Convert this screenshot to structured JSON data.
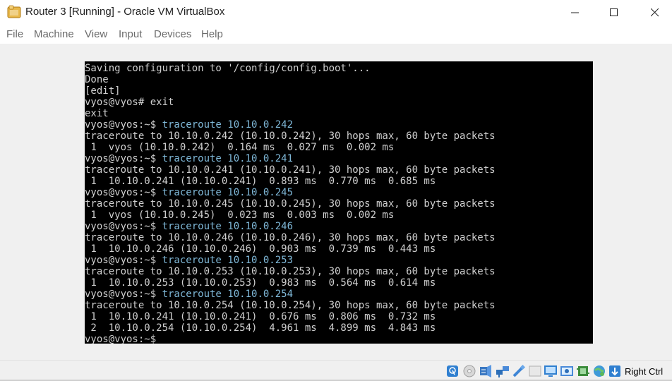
{
  "window": {
    "title": "Router 3 [Running] - Oracle VM VirtualBox",
    "controls": [
      "minimize",
      "maximize",
      "close"
    ]
  },
  "menu": {
    "items": [
      {
        "label": "File"
      },
      {
        "label": "Machine"
      },
      {
        "label": "View"
      },
      {
        "label": "Input"
      },
      {
        "label": "Devices"
      },
      {
        "label": "Help"
      }
    ]
  },
  "terminal": {
    "colors": {
      "background": "#000000",
      "text": "#cfcfcf",
      "command": "#7fb8d8"
    },
    "lines": [
      {
        "text": "Saving configuration to '/config/config.boot'...",
        "cmd": ""
      },
      {
        "text": "Done",
        "cmd": ""
      },
      {
        "text": "[edit]",
        "cmd": ""
      },
      {
        "text": "vyos@vyos# exit",
        "cmd": ""
      },
      {
        "text": "exit",
        "cmd": ""
      },
      {
        "text": "vyos@vyos:~$ ",
        "cmd": "traceroute 10.10.0.242"
      },
      {
        "text": "traceroute to 10.10.0.242 (10.10.0.242), 30 hops max, 60 byte packets",
        "cmd": ""
      },
      {
        "text": " 1  vyos (10.10.0.242)  0.164 ms  0.027 ms  0.002 ms",
        "cmd": ""
      },
      {
        "text": "vyos@vyos:~$ ",
        "cmd": "traceroute 10.10.0.241"
      },
      {
        "text": "traceroute to 10.10.0.241 (10.10.0.241), 30 hops max, 60 byte packets",
        "cmd": ""
      },
      {
        "text": " 1  10.10.0.241 (10.10.0.241)  0.893 ms  0.770 ms  0.685 ms",
        "cmd": ""
      },
      {
        "text": "vyos@vyos:~$ ",
        "cmd": "traceroute 10.10.0.245"
      },
      {
        "text": "traceroute to 10.10.0.245 (10.10.0.245), 30 hops max, 60 byte packets",
        "cmd": ""
      },
      {
        "text": " 1  vyos (10.10.0.245)  0.023 ms  0.003 ms  0.002 ms",
        "cmd": ""
      },
      {
        "text": "vyos@vyos:~$ ",
        "cmd": "traceroute 10.10.0.246"
      },
      {
        "text": "traceroute to 10.10.0.246 (10.10.0.246), 30 hops max, 60 byte packets",
        "cmd": ""
      },
      {
        "text": " 1  10.10.0.246 (10.10.0.246)  0.903 ms  0.739 ms  0.443 ms",
        "cmd": ""
      },
      {
        "text": "vyos@vyos:~$ ",
        "cmd": "traceroute 10.10.0.253"
      },
      {
        "text": "traceroute to 10.10.0.253 (10.10.0.253), 30 hops max, 60 byte packets",
        "cmd": ""
      },
      {
        "text": " 1  10.10.0.253 (10.10.0.253)  0.983 ms  0.564 ms  0.614 ms",
        "cmd": ""
      },
      {
        "text": "vyos@vyos:~$ ",
        "cmd": "traceroute 10.10.0.254"
      },
      {
        "text": "traceroute to 10.10.0.254 (10.10.0.254), 30 hops max, 60 byte packets",
        "cmd": ""
      },
      {
        "text": " 1  10.10.0.241 (10.10.0.241)  0.676 ms  0.806 ms  0.732 ms",
        "cmd": ""
      },
      {
        "text": " 2  10.10.0.254 (10.10.0.254)  4.961 ms  4.899 ms  4.843 ms",
        "cmd": ""
      },
      {
        "text": "vyos@vyos:~$",
        "cmd": ""
      }
    ]
  },
  "statusbar": {
    "icons": [
      "hard-disk-icon",
      "optical-drive-icon",
      "audio-icon",
      "network-icon",
      "usb-icon",
      "shared-folders-icon",
      "display-icon",
      "recording-icon",
      "cpu-icon",
      "network-globe-icon",
      "keyboard-capture-icon"
    ],
    "host_key": "Right Ctrl"
  }
}
